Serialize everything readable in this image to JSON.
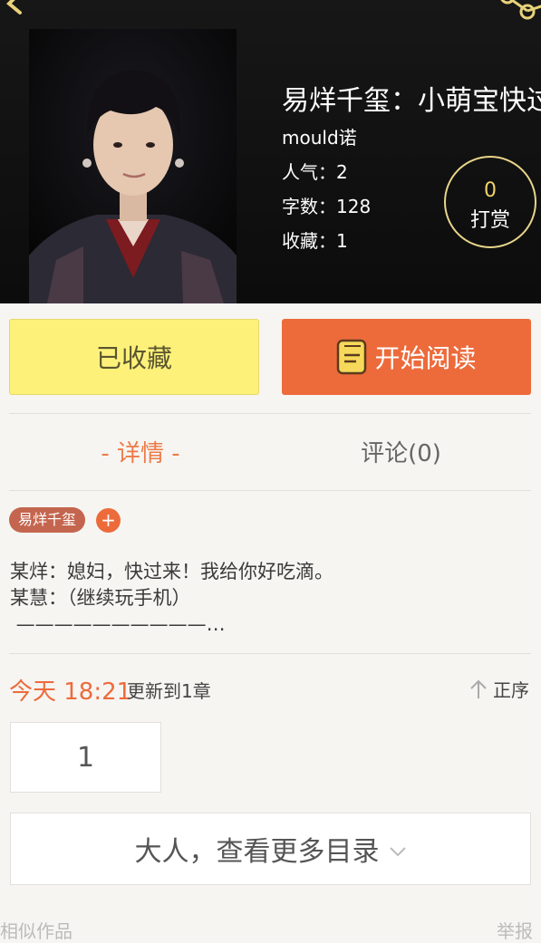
{
  "book": {
    "title": "易烊千玺：小萌宝快过来",
    "author": "mould诺",
    "popularity": "人气：2",
    "word_count": "字数：128",
    "favorites": "收藏：1"
  },
  "reward": {
    "count": "0",
    "label": "打赏"
  },
  "actions": {
    "favorited_label": "已收藏",
    "read_label": "开始阅读"
  },
  "tabs": {
    "detail": "- 详情 -",
    "comments": "评论(0)"
  },
  "tags": {
    "tag": "易烊千玺",
    "add": "+"
  },
  "synopsis": "某烊：媳妇，快过来！我给你好吃滴。\n某慧：（继续玩手机）\n ——————————…",
  "update": {
    "time": "今天 18:21",
    "text": "更新到1章",
    "sort_label": "正序"
  },
  "chapters": {
    "first": "1",
    "more_label": "大人，查看更多目录"
  },
  "footer": {
    "similar": "相似作品",
    "report": "举报"
  },
  "colors": {
    "accent": "#ed6b3b",
    "favorite_bg": "#fdf17a",
    "reward_ring": "#e8d58a",
    "header_bg": "#111111"
  },
  "icons": {
    "back": "back-arrow-icon",
    "share": "share-icon",
    "book": "book-icon",
    "sort": "sort-up-arrow-icon",
    "chevron": "chevron-down-icon"
  }
}
